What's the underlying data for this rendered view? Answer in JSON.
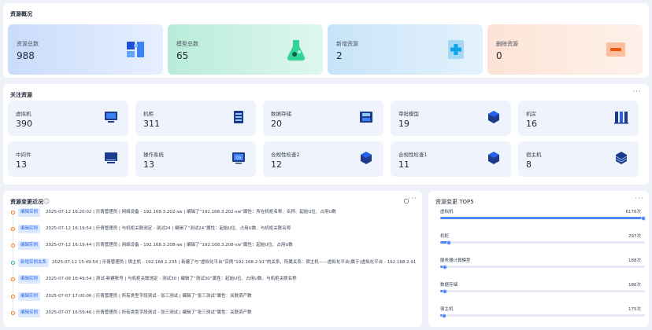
{
  "overview": {
    "title": "资源概况",
    "cards": [
      {
        "label": "资源总数",
        "value": "988",
        "icon": "puzzle-icon",
        "bg": "#d6e4fb"
      },
      {
        "label": "模型总数",
        "value": "65",
        "icon": "flask-icon",
        "bg": "#c9f0e1"
      },
      {
        "label": "新增资源",
        "value": "2",
        "icon": "add-box-icon",
        "bg": "#d6ecf9"
      },
      {
        "label": "删除资源",
        "value": "0",
        "icon": "delete-box-icon",
        "bg": "#fde4d8"
      }
    ]
  },
  "focus": {
    "title": "关注资源",
    "more": "···",
    "cards": [
      {
        "label": "虚拟机",
        "value": "390",
        "icon": "vm-monitor-icon"
      },
      {
        "label": "机柜",
        "value": "311",
        "icon": "cabinet-icon"
      },
      {
        "label": "数据存储",
        "value": "20",
        "icon": "storage-icon"
      },
      {
        "label": "审批模型",
        "value": "19",
        "icon": "cube-icon"
      },
      {
        "label": "机房",
        "value": "16",
        "icon": "server-room-icon"
      },
      {
        "label": "中间件",
        "value": "13",
        "icon": "monitor-icon"
      },
      {
        "label": "操作系统",
        "value": "13",
        "icon": "os-icon"
      },
      {
        "label": "合规性检查2",
        "value": "12",
        "icon": "cube-icon"
      },
      {
        "label": "合规性检查1",
        "value": "11",
        "icon": "cube-icon"
      },
      {
        "label": "宿主机",
        "value": "8",
        "icon": "host-cube-icon"
      }
    ]
  },
  "recent": {
    "title": "资源变更近况",
    "info_icon": "info-icon",
    "refresh_icon": "refresh-icon",
    "more": "···",
    "items": [
      {
        "tag": "编辑实例",
        "text": "2025-07-12 16:20:02  |  乐倩管理员  |  网络设备 - 192.168.3.202-sw  |  编辑了“192.168.3.202-sw”属性：所在机柜名称、名称、起始U位、占用U数"
      },
      {
        "tag": "编辑实例",
        "text": "2025-07-12 16:19:54  |  乐倩管理员  |  与机柜关联测定 - 测试24  |  编辑了“测试24”属性：起始U位、占用U数、与机柜关联名称"
      },
      {
        "tag": "编辑实例",
        "text": "2025-07-12 16:19:44  |  乐倩管理员  |  网络设备 - 192.168.3.208-sw  |  编辑了“192.168.3.208-sw”属性：起始U位、占用U数"
      },
      {
        "tag": "新增实例关系",
        "text": "2025-07-12 15:49:54  |  乐倩管理员  |  宿主机 - 192.168.1.235  |  新建了与“虚拟化平台”实例“192.168.2.91”的关系，所属关系：宿主机——虚拟化平台(属于)虚拟化平台 - 192.168.2.91"
      },
      {
        "tag": "编辑实例",
        "text": "2025-07-08 16:49:54  |  测试-新建账号  |  与机柜关联测定 - 测试30  |  编辑了“测试30”属性：起始U位、占用U数、与机柜关联名称"
      },
      {
        "tag": "编辑实例",
        "text": "2025-07-07 17:00:06  |  乐倩管理员  |  所有类型字段测试 - 张三测试  |  编辑了“张三测试”属性：关联资产数"
      },
      {
        "tag": "编辑实例",
        "text": "2025-07-07 16:59:46  |  乐倩管理员  |  所有类型字段测试 - 张三测试  |  编辑了“张三测试”属性：关联资产数"
      }
    ]
  },
  "tops": {
    "title": "资源变更 TOP5",
    "more": "···",
    "max": 6176,
    "items": [
      {
        "label": "虚拟机",
        "value": "6176次",
        "count": 6176
      },
      {
        "label": "机柜",
        "value": "297次",
        "count": 297
      },
      {
        "label": "服务器计算模型",
        "value": "188次",
        "count": 188
      },
      {
        "label": "数据存储",
        "value": "186次",
        "count": 186
      },
      {
        "label": "宿主机",
        "value": "175次",
        "count": 175
      }
    ]
  }
}
